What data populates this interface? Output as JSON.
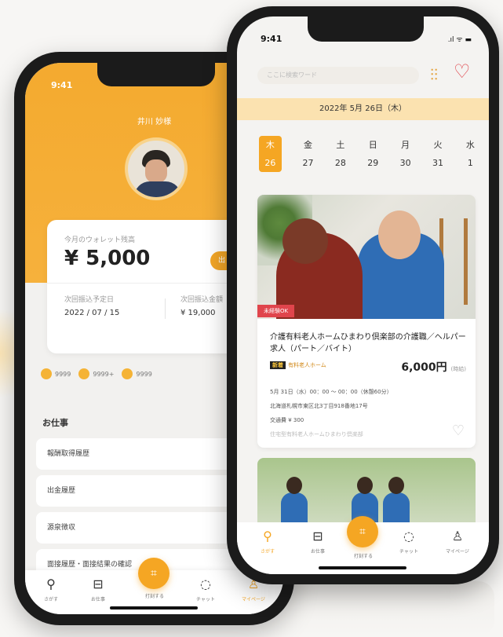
{
  "back_phone": {
    "time": "9:41",
    "user_name": "井川 妙様",
    "wallet": {
      "label": "今月のウォレット残高",
      "amount": "¥ 5,000",
      "button_label": "出",
      "next_date_label": "次回振込予定日",
      "next_date": "2022 / 07 / 15",
      "next_amount_label": "次回振込金額",
      "next_amount": "¥ 19,000"
    },
    "badges": [
      {
        "value": "9999"
      },
      {
        "value": "9999+"
      },
      {
        "value": "9999"
      }
    ],
    "section_title": "お仕事",
    "menu_items": [
      "報酬取得履歴",
      "出金履歴",
      "源泉徴収",
      "面接履歴・面接結果の確認"
    ],
    "nav": [
      {
        "icon": "search-icon",
        "label": "さがす"
      },
      {
        "icon": "briefcase-icon",
        "label": "お仕事"
      },
      {
        "icon": "scan-icon",
        "label": "打刻する"
      },
      {
        "icon": "chat-icon",
        "label": "チャット"
      },
      {
        "icon": "user-icon",
        "label": "マイページ"
      }
    ]
  },
  "front_phone": {
    "time": "9:41",
    "status": ".ıl ᯤ ▬",
    "search_placeholder": "ここに検索ワード",
    "date_bar": "2022年 5月 26日（木）",
    "days": [
      {
        "name": "木",
        "date": "26",
        "active": true
      },
      {
        "name": "金",
        "date": "27"
      },
      {
        "name": "土",
        "date": "28"
      },
      {
        "name": "日",
        "date": "29"
      },
      {
        "name": "月",
        "date": "30"
      },
      {
        "name": "火",
        "date": "31"
      },
      {
        "name": "水",
        "date": "1"
      }
    ],
    "job": {
      "tag": "未経験OK",
      "title": "介護有料老人ホームひまわり倶楽部の介護職／ヘルパー求人（パート／バイト）",
      "pill_strong": "新着",
      "pill_text": "有料老人ホーム",
      "salary": "6,000円",
      "salary_note": "(時給)",
      "datetime": "5月 31日（水）00：00 ～ 00：00（休憩60分）",
      "address": "北海道札幌市東区北3丁目918番地17号",
      "transport": "交通費 ¥ 300",
      "company": "住宅型有料老人ホームひまわり倶楽部"
    },
    "nav": [
      {
        "icon": "search-icon",
        "label": "さがす"
      },
      {
        "icon": "briefcase-icon",
        "label": "お仕事"
      },
      {
        "icon": "scan-icon",
        "label": "打刻する"
      },
      {
        "icon": "chat-icon",
        "label": "チャット"
      },
      {
        "icon": "user-icon",
        "label": "マイページ"
      }
    ]
  },
  "colors": {
    "accent": "#f5a623",
    "heart": "#e0454c",
    "date_bar": "#fbe2b0"
  }
}
